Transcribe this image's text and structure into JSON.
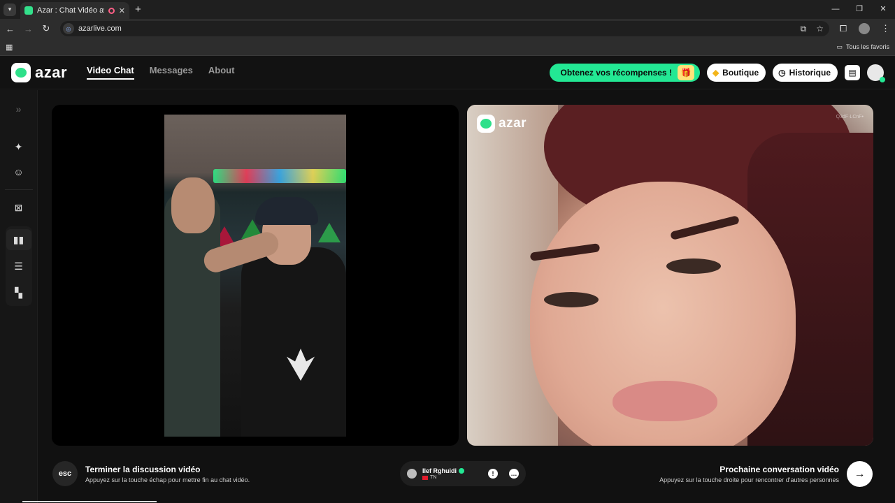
{
  "browser": {
    "tab_title": "Azar : Chat Vidéo avec de n",
    "close_glyph": "✕",
    "newtab_glyph": "+",
    "url": "azarlive.com",
    "bookmarks_folder": "Tous les favoris",
    "window_controls": [
      "—",
      "❐",
      "✕"
    ]
  },
  "header": {
    "logo_text": "azar",
    "nav": [
      "Video Chat",
      "Messages",
      "About"
    ],
    "rewards_label": "Obtenez vos récompenses !",
    "shop_label": "Boutique",
    "history_label": "Historique"
  },
  "left_video": {},
  "right_video": {
    "watermark": "azar",
    "stream_id": "Q3dF·LCnF•"
  },
  "bottom": {
    "esc_label": "esc",
    "end_title": "Terminer la discussion vidéo",
    "end_sub": "Appuyez sur la touche échap pour mettre fin au chat vidéo.",
    "peer_name": "Ilef Rghuidi",
    "peer_country": "TN",
    "next_title": "Prochaine conversation vidéo",
    "next_sub": "Appuyez sur la touche droite pour rencontrer d'autres personnes",
    "next_arrow": "→"
  },
  "colors": {
    "accent": "#23e894",
    "background": "#111111"
  }
}
